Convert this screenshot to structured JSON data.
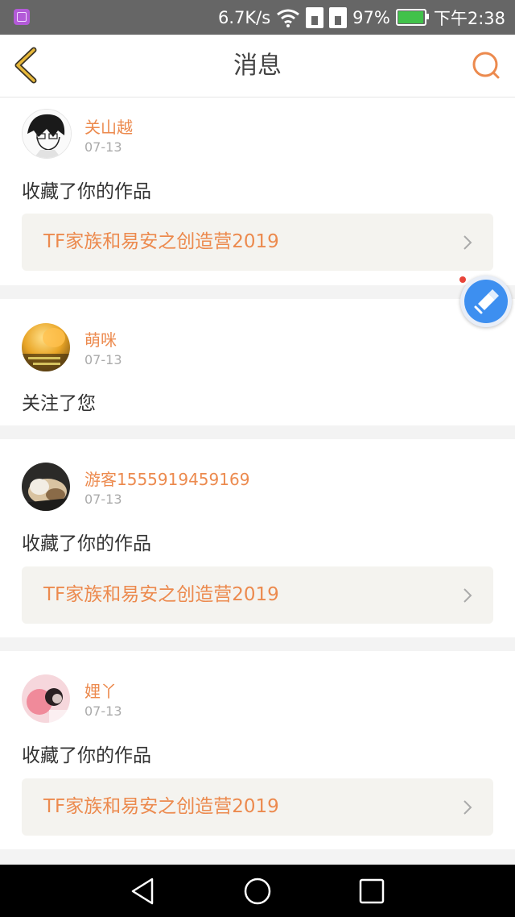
{
  "status_bar": {
    "network_speed": "6.7K/s",
    "battery_percent": "97%",
    "time": "下午2:38",
    "icons": [
      "gallery-app-icon",
      "wifi-icon",
      "sim-card-icon",
      "sim-card-icon",
      "battery-charging-icon"
    ]
  },
  "header": {
    "title": "消息",
    "back_icon": "back-chevron-icon",
    "search_icon": "search-icon"
  },
  "messages": [
    {
      "user": "关山越",
      "date": "07-13",
      "action": "收藏了你的作品",
      "work_title": "TF家族和易安之创造营2019"
    },
    {
      "user": "萌咪",
      "date": "07-13",
      "action": "关注了您"
    },
    {
      "user": "游客1555919459169",
      "date": "07-13",
      "action": "收藏了你的作品",
      "work_title": "TF家族和易安之创造营2019"
    },
    {
      "user": "娌丫",
      "date": "07-13",
      "action": "收藏了你的作品",
      "work_title": "TF家族和易安之创造营2019"
    }
  ],
  "floating_button": {
    "icon": "float-tool-icon",
    "has_notification_dot": true
  },
  "nav_bar": {
    "buttons": [
      "back-triangle-icon",
      "home-circle-icon",
      "recents-square-icon"
    ]
  },
  "colors": {
    "accent": "#ec8a4e",
    "back_chevron": "#e0a82a",
    "card_bg": "#f4f3ef",
    "separator": "#f3f3f3",
    "status_bar": "#666666",
    "float_button": "#3d8ff0"
  }
}
